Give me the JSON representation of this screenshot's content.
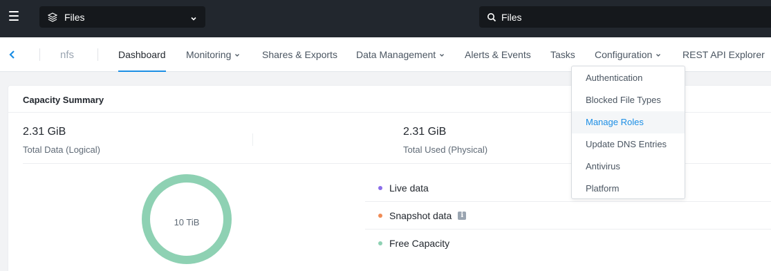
{
  "topbar": {
    "app_selector": "Files",
    "search_value": "Files"
  },
  "subnav": {
    "entity": "nfs",
    "tabs": [
      {
        "label": "Dashboard",
        "active": true,
        "has_menu": false
      },
      {
        "label": "Monitoring",
        "active": false,
        "has_menu": true
      },
      {
        "label": "Shares & Exports",
        "active": false,
        "has_menu": false
      },
      {
        "label": "Data Management",
        "active": false,
        "has_menu": true
      },
      {
        "label": "Alerts & Events",
        "active": false,
        "has_menu": false
      },
      {
        "label": "Tasks",
        "active": false,
        "has_menu": false
      },
      {
        "label": "Configuration",
        "active": false,
        "has_menu": true
      },
      {
        "label": "REST API Explorer",
        "active": false,
        "has_menu": false
      }
    ]
  },
  "configuration_menu": {
    "items": [
      {
        "label": "Authentication",
        "hovered": false
      },
      {
        "label": "Blocked File Types",
        "hovered": false
      },
      {
        "label": "Manage Roles",
        "hovered": true
      },
      {
        "label": "Update DNS Entries",
        "hovered": false
      },
      {
        "label": "Antivirus",
        "hovered": false
      },
      {
        "label": "Platform",
        "hovered": false
      }
    ]
  },
  "capacity_summary": {
    "title": "Capacity Summary",
    "total_data": {
      "value": "2.31 GiB",
      "label": "Total Data (Logical)"
    },
    "total_used": {
      "value": "2.31 GiB",
      "label": "Total Used (Physical)"
    },
    "donut_center": "10 TiB",
    "legend": [
      {
        "label": "Live data",
        "color": "#8a6de9"
      },
      {
        "label": "Snapshot data",
        "color": "#f08b55",
        "info": true
      },
      {
        "label": "Free Capacity",
        "color": "#8ed1b3"
      }
    ]
  },
  "colors": {
    "accent": "#1b8ee5",
    "topbar": "#22272e",
    "free_capacity": "#8ed1b3"
  }
}
